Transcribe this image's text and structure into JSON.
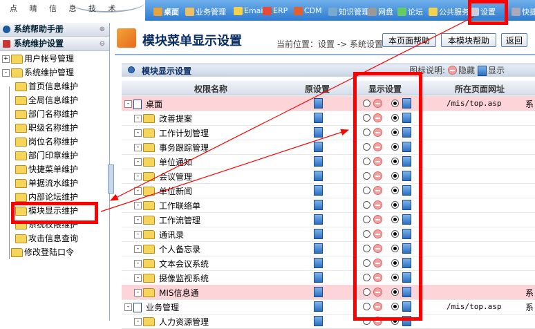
{
  "logo": {
    "text": "点 晴 信 息 技 术"
  },
  "topnav": [
    {
      "label": "桌面",
      "icon": "desktop-icon",
      "color": "#e8a33a"
    },
    {
      "label": "业务管理",
      "icon": "user-icon",
      "color": "#f0c060"
    },
    {
      "label": "Email",
      "icon": "mail-icon",
      "color": "#f4d24d"
    },
    {
      "label": "ERP",
      "icon": "erp-icon",
      "color": "#e84a3a"
    },
    {
      "label": "CDM",
      "icon": "cdm-icon",
      "color": "#e06030"
    },
    {
      "label": "知识管理",
      "icon": "knowledge-icon",
      "color": "#7ac"
    },
    {
      "label": "网盘",
      "icon": "disk-icon",
      "color": "#999"
    },
    {
      "label": "论坛",
      "icon": "forum-icon",
      "color": "#6c6"
    },
    {
      "label": "公共服务",
      "icon": "flower-icon",
      "color": "#f4d24d"
    },
    {
      "label": "设置",
      "icon": "tools-icon",
      "color": "#ccd"
    },
    {
      "label": "快捷",
      "icon": "shortcut-icon",
      "color": "#aab"
    }
  ],
  "sidebar": {
    "section1": "系统帮助手册",
    "section2": "系统维护设置",
    "tree": [
      {
        "label": "用户帐号管理",
        "level": 0,
        "toggle": "+"
      },
      {
        "label": "系统维护管理",
        "level": 0,
        "toggle": "-"
      },
      {
        "label": "首页信息维护",
        "level": 1
      },
      {
        "label": "全局信息维护",
        "level": 1
      },
      {
        "label": "部门名称维护",
        "level": 1
      },
      {
        "label": "职级名称维护",
        "level": 1
      },
      {
        "label": "岗位名称维护",
        "level": 1
      },
      {
        "label": "部门印章维护",
        "level": 1
      },
      {
        "label": "快捷菜单维护",
        "level": 1
      },
      {
        "label": "单据流水维护",
        "level": 1
      },
      {
        "label": "内部论坛维护",
        "level": 1
      },
      {
        "label": "模块显示维护",
        "level": 1
      },
      {
        "label": "系统权限维护",
        "level": 1
      },
      {
        "label": "攻击信息查询",
        "level": 1
      },
      {
        "label": "修改登陆口令",
        "level": 0
      }
    ]
  },
  "main": {
    "title": "模块菜单显示设置",
    "breadcrumb": "当前位置：设置 -> 系统设置",
    "buttons": {
      "page_help": "本页面帮助",
      "module_help": "本模块帮助",
      "back": "返回"
    },
    "panel_title": "模块显示设置",
    "legend": {
      "label": "图标说明:",
      "hide": "隐藏",
      "show": "显示"
    },
    "columns": {
      "name": "权限名称",
      "original": "原设置",
      "display": "显示设置",
      "url": "所在页面网址"
    },
    "rows": [
      {
        "label": "桌面",
        "top": true,
        "pink": true,
        "url": "/mis/top.asp",
        "extra": "系"
      },
      {
        "label": "改善提案"
      },
      {
        "label": "工作计划管理"
      },
      {
        "label": "事务跟踪管理"
      },
      {
        "label": "单位通知"
      },
      {
        "label": "会议管理"
      },
      {
        "label": "单位新闻"
      },
      {
        "label": "工作联络单"
      },
      {
        "label": "工作流管理"
      },
      {
        "label": "通讯录"
      },
      {
        "label": "个人备忘录"
      },
      {
        "label": "文本会议系统"
      },
      {
        "label": "摄像监视系统"
      },
      {
        "label": "MIS信息通",
        "pink": true,
        "extra": "系"
      },
      {
        "label": "业务管理",
        "top": true,
        "url": "/mis/top.asp",
        "extra": "系"
      },
      {
        "label": "人力资源管理"
      }
    ]
  },
  "colors": {
    "topbar": "#3a86d8",
    "annotation": "#ff0000",
    "highlight_row": "#fdd5d8"
  }
}
